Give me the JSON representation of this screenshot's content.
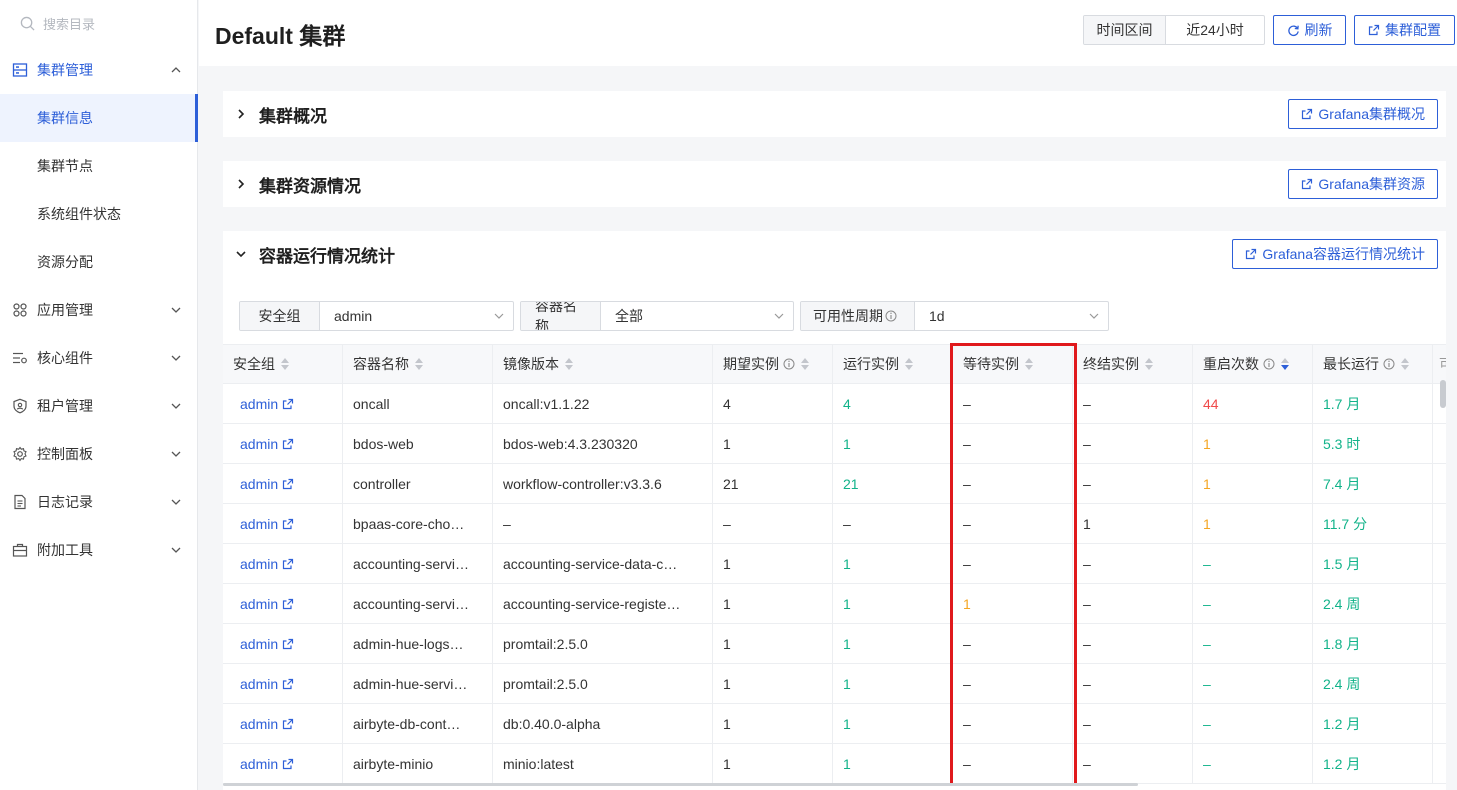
{
  "sidebar": {
    "search_placeholder": "搜索目录",
    "cluster_mgmt": "集群管理",
    "sub_items": [
      "集群信息",
      "集群节点",
      "系统组件状态",
      "资源分配"
    ],
    "groups": [
      "应用管理",
      "核心组件",
      "租户管理",
      "控制面板",
      "日志记录",
      "附加工具"
    ]
  },
  "header": {
    "title": "Default 集群",
    "time_range_label": "时间区间",
    "time_range_value": "近24小时",
    "refresh": "刷新",
    "cluster_config": "集群配置"
  },
  "panels": {
    "overview": {
      "title": "集群概况",
      "grafana": "Grafana集群概况"
    },
    "resources": {
      "title": "集群资源情况",
      "grafana": "Grafana集群资源"
    },
    "containers": {
      "title": "容器运行情况统计",
      "grafana": "Grafana容器运行情况统计"
    }
  },
  "filters": {
    "security_group": {
      "label": "安全组",
      "value": "admin"
    },
    "container_name": {
      "label": "容器名称",
      "value": "全部"
    },
    "availability": {
      "label": "可用性周期",
      "value": "1d"
    }
  },
  "table": {
    "columns": [
      "安全组",
      "容器名称",
      "镜像版本",
      "期望实例",
      "运行实例",
      "等待实例",
      "终结实例",
      "重启次数",
      "最长运行",
      "可"
    ],
    "rows": [
      [
        "admin",
        "oncall",
        "oncall:v1.1.22",
        "4",
        "4",
        "–",
        "–",
        "44",
        "1.7 月"
      ],
      [
        "admin",
        "bdos-web",
        "bdos-web:4.3.230320",
        "1",
        "1",
        "–",
        "–",
        "1",
        "5.3 时"
      ],
      [
        "admin",
        "controller",
        "workflow-controller:v3.3.6",
        "21",
        "21",
        "–",
        "–",
        "1",
        "7.4 月"
      ],
      [
        "admin",
        "bpaas-core-cho…",
        "–",
        "–",
        "–",
        "–",
        "1",
        "1",
        "11.7 分"
      ],
      [
        "admin",
        "accounting-servi…",
        "accounting-service-data-c…",
        "1",
        "1",
        "–",
        "–",
        "–",
        "1.5 月"
      ],
      [
        "admin",
        "accounting-servi…",
        "accounting-service-registe…",
        "1",
        "1",
        "1",
        "–",
        "–",
        "2.4 周"
      ],
      [
        "admin",
        "admin-hue-logs…",
        "promtail:2.5.0",
        "1",
        "1",
        "–",
        "–",
        "–",
        "1.8 月"
      ],
      [
        "admin",
        "admin-hue-servi…",
        "promtail:2.5.0",
        "1",
        "1",
        "–",
        "–",
        "–",
        "2.4 周"
      ],
      [
        "admin",
        "airbyte-db-cont…",
        "db:0.40.0-alpha",
        "1",
        "1",
        "–",
        "–",
        "–",
        "1.2 月"
      ],
      [
        "admin",
        "airbyte-minio",
        "minio:latest",
        "1",
        "1",
        "–",
        "–",
        "–",
        "1.2 月"
      ]
    ]
  },
  "colors": {
    "accent": "#2d5fd8",
    "green": "#12b38a",
    "red": "#f04b4b",
    "orange": "#f5a623",
    "highlight": "#e0191c"
  }
}
